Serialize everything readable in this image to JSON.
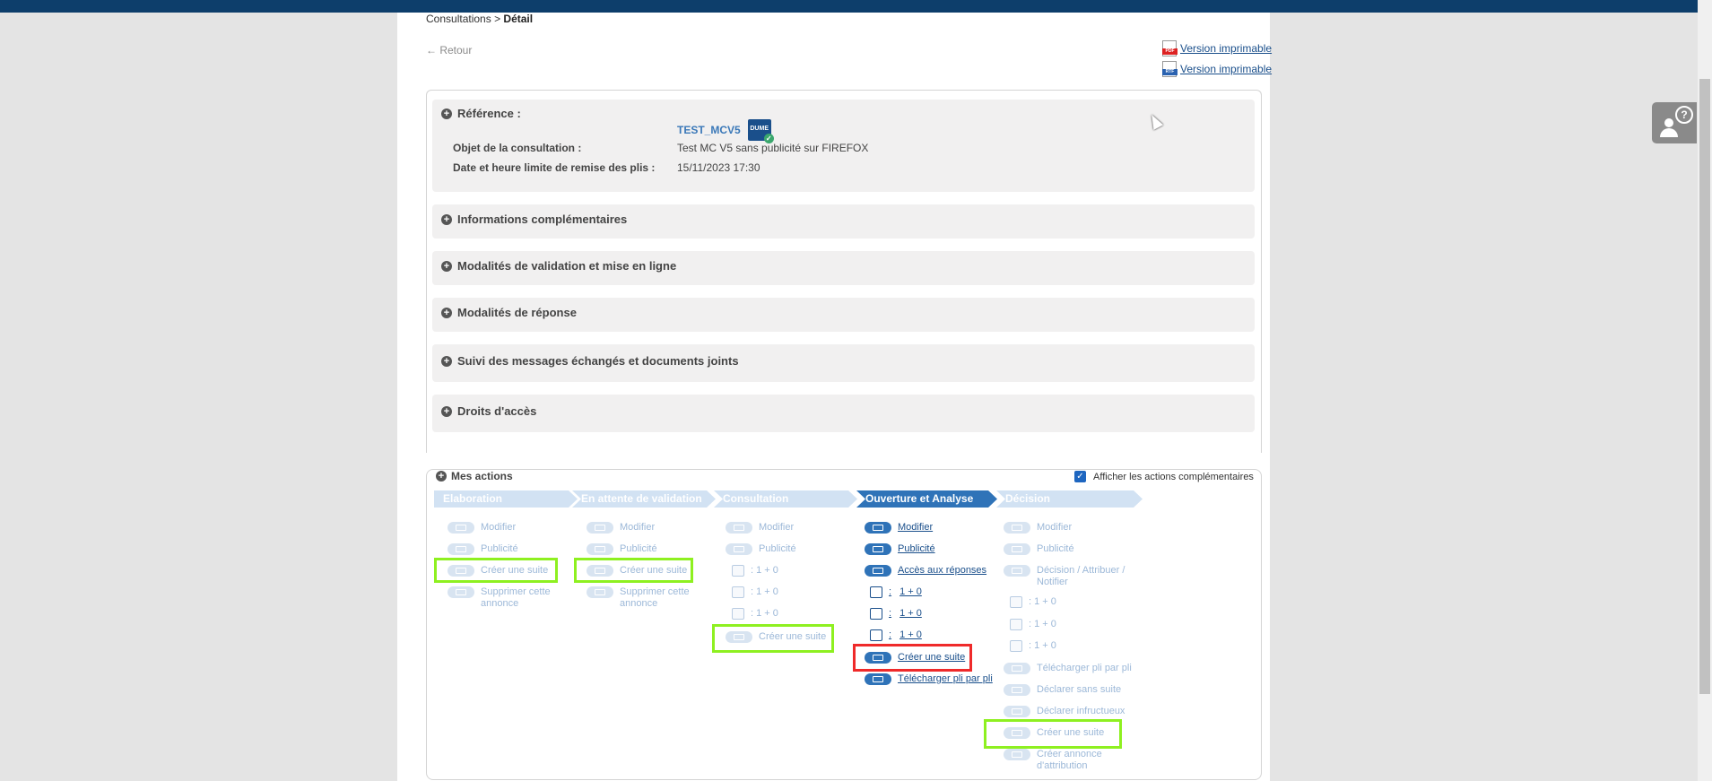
{
  "header": {
    "breadcrumb_root": "Consultations",
    "breadcrumb_sep": ">",
    "breadcrumb_current": "Détail",
    "back_label": "← Retour",
    "print_pdf_label": "Version imprimable",
    "print_rtf_label": "Version imprimable",
    "pdf_tag": "PDF",
    "rtf_tag": "RTF"
  },
  "reference": {
    "label": "Référence :",
    "value": "TEST_MCV5",
    "badge": "DUME",
    "object_label": "Objet de la consultation :",
    "object_value": "Test MC V5 sans publicité sur FIREFOX",
    "deadline_label": "Date et heure limite de remise des plis :",
    "deadline_value": "15/11/2023 17:30"
  },
  "panels": [
    "Informations complémentaires",
    "Modalités de validation et mise en ligne",
    "Modalités de réponse",
    "Suivi des messages échangés et documents joints",
    "Droits d'accès"
  ],
  "actions": {
    "title": "Mes actions",
    "show_more_label": "Afficher les actions complémentaires",
    "steps": [
      "Elaboration",
      "En attente de validation",
      "Consultation",
      "Ouverture et Analyse",
      "Décision"
    ],
    "col1": [
      "Modifier",
      "Publicité",
      "Créer une suite",
      "Supprimer cette annonce"
    ],
    "col2": [
      "Modifier",
      "Publicité",
      "Créer une suite",
      "Supprimer cette annonce"
    ],
    "col3": [
      "Modifier",
      "Publicité",
      ": 1 + 0",
      ": 1 + 0",
      ": 1 + 0",
      "Créer une suite"
    ],
    "col4": [
      "Modifier",
      "Publicité",
      "Accès aux réponses",
      "1 + 0",
      "1 + 0",
      "1 + 0",
      "Créer une suite",
      "Télécharger pli par pli"
    ],
    "col5": [
      "Modifier",
      "Publicité",
      "Décision / Attribuer / Notifier",
      ": 1 + 0",
      ": 1 + 0",
      ": 1 + 0",
      "Télécharger pli par pli",
      "Déclarer sans suite",
      "Déclarer infructueux",
      "Créer une suite",
      "Créer annonce d'attribution"
    ],
    "colon": ":"
  },
  "colors": {
    "topbar": "#0d3e6b",
    "active_step": "#2f73b8",
    "inactive_step": "#d2e2f3",
    "highlight_green": "#8ef020",
    "highlight_red": "#ef2a2a"
  }
}
